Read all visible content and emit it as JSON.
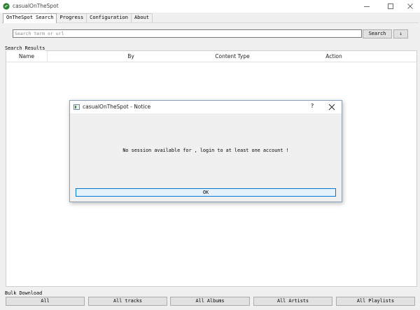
{
  "window": {
    "title": "casualOnTheSpot"
  },
  "tabs": [
    {
      "label": "OnTheSpot Search",
      "active": true
    },
    {
      "label": "Progress",
      "active": false
    },
    {
      "label": "Configuration",
      "active": false
    },
    {
      "label": "About",
      "active": false
    }
  ],
  "search": {
    "placeholder": "Search term or url",
    "value": "",
    "search_label": "Search",
    "sort_label": "↓"
  },
  "results": {
    "group_title": "Search Results",
    "columns": [
      "Name",
      "By",
      "Content Type",
      "Action"
    ],
    "rows": []
  },
  "bulk": {
    "group_title": "Bulk Download",
    "buttons": [
      "All",
      "All tracks",
      "All Albums",
      "All Artists",
      "All Playlists"
    ]
  },
  "dialog": {
    "title": "casualOnTheSpot - Notice",
    "help_label": "?",
    "message": "No session available for , login to at least one account !",
    "ok_label": "OK"
  },
  "colors": {
    "window_bg": "#f0f0f0",
    "accent_border": "#0078d7",
    "button_bg": "#e1e1e1",
    "app_icon_green": "#2e7d32"
  }
}
